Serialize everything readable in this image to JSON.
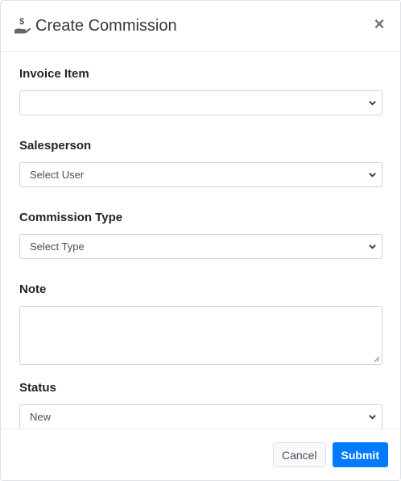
{
  "header": {
    "title": "Create Commission",
    "icon": "hand-dollar-icon"
  },
  "form": {
    "invoice_item": {
      "label": "Invoice Item",
      "value": ""
    },
    "salesperson": {
      "label": "Salesperson",
      "value": "Select User"
    },
    "commission_type": {
      "label": "Commission Type",
      "value": "Select Type"
    },
    "note": {
      "label": "Note",
      "value": ""
    },
    "status": {
      "label": "Status",
      "value": "New"
    }
  },
  "footer": {
    "cancel_label": "Cancel",
    "submit_label": "Submit"
  },
  "colors": {
    "primary": "#007bff",
    "border": "#ced4da"
  }
}
